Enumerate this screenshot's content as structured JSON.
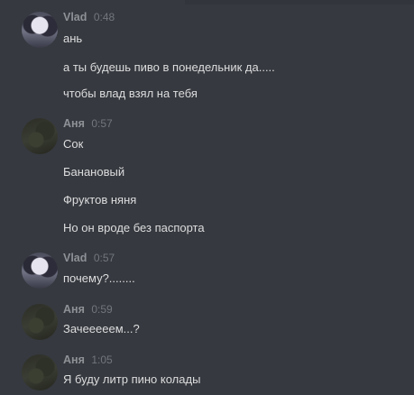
{
  "messages": [
    {
      "author": "Vlad",
      "time": "0:48",
      "avatar": "vlad-avatar",
      "lines": [
        "ань",
        "а ты будешь пиво в понедельник да.....",
        "чтобы влад взял на тебя"
      ]
    },
    {
      "author": "Аня",
      "time": "0:57",
      "avatar": "anya-avatar",
      "lines": [
        "Сок",
        "Банановый",
        "Фруктов няня",
        "Но он вроде без паспорта"
      ]
    },
    {
      "author": "Vlad",
      "time": "0:57",
      "avatar": "vlad-avatar",
      "lines": [
        "почему?........"
      ]
    },
    {
      "author": "Аня",
      "time": "0:59",
      "avatar": "anya-avatar",
      "lines": [
        "Зачееееем...?"
      ]
    },
    {
      "author": "Аня",
      "time": "1:05",
      "avatar": "anya-avatar",
      "lines": [
        "Я буду литр пино колады"
      ]
    }
  ],
  "colors": {
    "background": "#36393f",
    "author": "#8e9297",
    "timestamp": "#72767d",
    "text": "#dcddde"
  }
}
